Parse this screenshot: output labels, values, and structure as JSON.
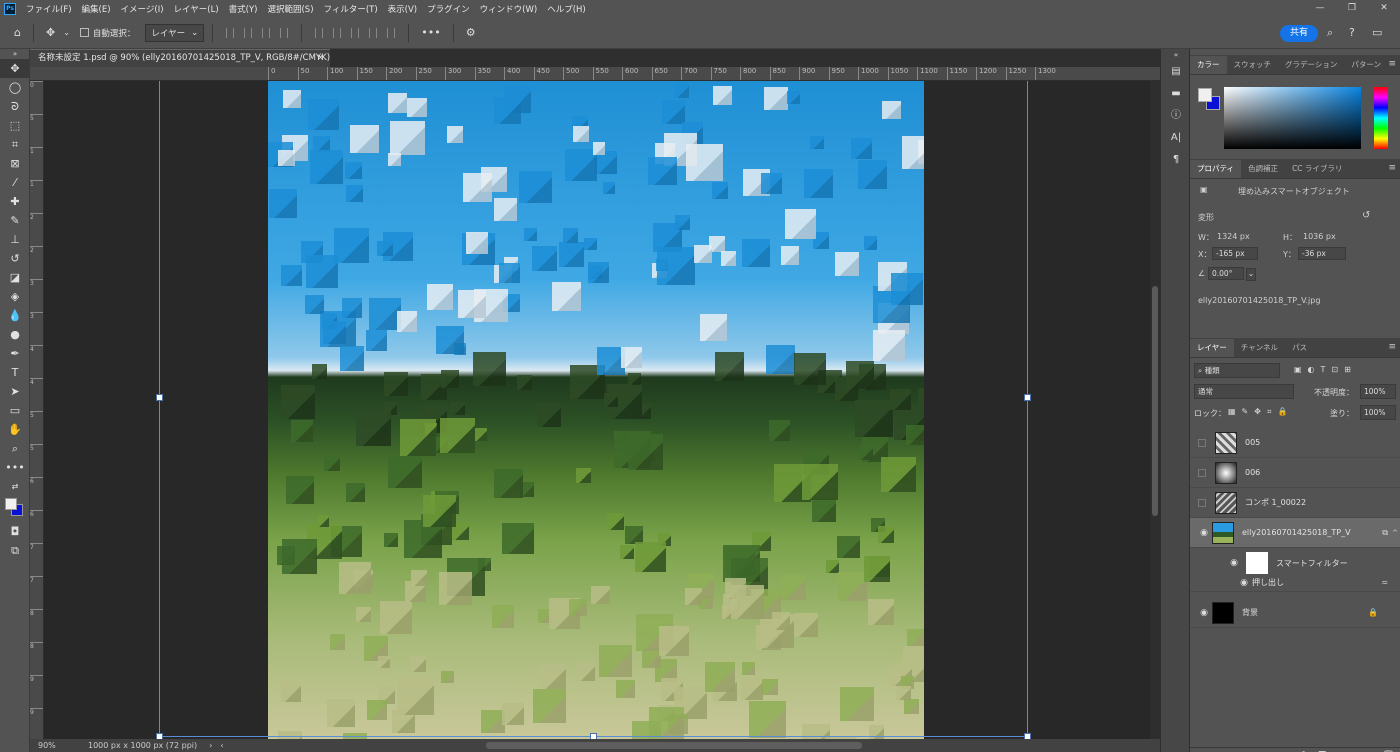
{
  "app": {
    "logo": "Ps",
    "menu": [
      "ファイル(F)",
      "編集(E)",
      "イメージ(I)",
      "レイヤー(L)",
      "書式(Y)",
      "選択範囲(S)",
      "フィルター(T)",
      "表示(V)",
      "プラグイン",
      "ウィンドウ(W)",
      "ヘルプ(H)"
    ],
    "window_controls": [
      "—",
      "❐",
      "✕"
    ]
  },
  "options_bar": {
    "auto_select_label": "自動選択：",
    "target_dropdown": "レイヤー",
    "more": "•••",
    "share_label": "共有"
  },
  "document": {
    "tab_title": "名称未設定 1.psd @ 90% (elly20160701425018_TP_V, RGB/8#/CMYK) *",
    "zoom": "90%",
    "doc_info": "1000 px x 1000 px (72 ppi)"
  },
  "ruler": {
    "top_ticks": [
      "0",
      "50",
      "100",
      "150",
      "200",
      "250",
      "300",
      "350",
      "400",
      "450",
      "500",
      "550",
      "600",
      "650",
      "700",
      "750",
      "800",
      "850",
      "900",
      "950",
      "1000",
      "1050",
      "1100",
      "1150",
      "1200",
      "1250",
      "1300"
    ],
    "left_ticks": [
      "0",
      "5",
      "1",
      "1",
      "2",
      "2",
      "3",
      "3",
      "4",
      "4",
      "5",
      "5",
      "6",
      "6",
      "7",
      "7",
      "8",
      "8",
      "9",
      "9"
    ]
  },
  "color_panel": {
    "tabs": [
      "カラー",
      "スウォッチ",
      "グラデーション",
      "パターン"
    ],
    "foreground": "#f0f0f0",
    "background": "#0a10d6"
  },
  "properties_panel": {
    "tabs": [
      "プロパティ",
      "色調補正",
      "CC ライブラリ"
    ],
    "object_type": "埋め込みスマートオブジェクト",
    "section": "変形",
    "w_label": "W：",
    "w_value": "1324 px",
    "h_label": "H：",
    "h_value": "1036 px",
    "x_label": "X：",
    "x_value": "-165 px",
    "y_label": "Y：",
    "y_value": "-36 px",
    "angle_value": "0.00°",
    "filename": "elly20160701425018_TP_V.jpg"
  },
  "layers_panel": {
    "tabs": [
      "レイヤー",
      "チャンネル",
      "パス"
    ],
    "filter_kind": "種類",
    "blend_mode": "通常",
    "opacity_label": "不透明度：",
    "opacity_value": "100%",
    "lock_label": "ロック：",
    "fill_label": "塗り：",
    "fill_value": "100%",
    "layers": [
      {
        "name": "005",
        "visible": false
      },
      {
        "name": "006",
        "visible": false
      },
      {
        "name": "コンポ 1_00022",
        "visible": false
      },
      {
        "name": "elly20160701425018_TP_V",
        "visible": true,
        "selected": true
      },
      {
        "name": "スマートフィルター",
        "visible": true
      },
      {
        "name": "押し出し",
        "visible": true
      },
      {
        "name": "背景",
        "visible": true
      }
    ]
  }
}
